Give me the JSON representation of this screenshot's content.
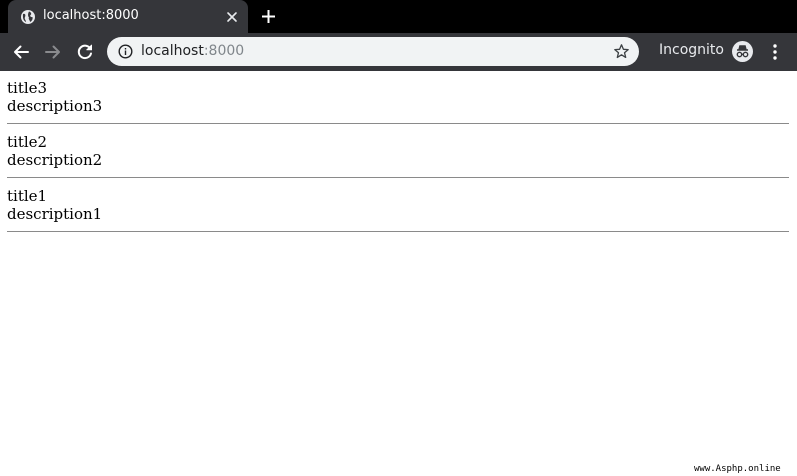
{
  "browser": {
    "tab": {
      "title": "localhost:8000"
    },
    "address": {
      "host": "localhost",
      "port": ":8000"
    },
    "profile": {
      "label": "Incognito"
    },
    "icons": {
      "favicon": "globe-icon",
      "close": "close-icon",
      "new_tab": "plus-icon",
      "back": "arrow-back-icon",
      "forward": "arrow-forward-icon",
      "reload": "reload-icon",
      "info": "info-icon",
      "bookmark": "star-icon",
      "incognito": "incognito-icon",
      "menu": "kebab-menu-icon"
    },
    "colors": {
      "tabstrip": "#000000",
      "toolbar": "#35363a",
      "omnibox": "#f1f3f4"
    }
  },
  "page": {
    "posts": [
      {
        "title": "title3",
        "description": "description3"
      },
      {
        "title": "title2",
        "description": "description2"
      },
      {
        "title": "title1",
        "description": "description1"
      }
    ]
  },
  "watermark": "www.Asphp.online"
}
